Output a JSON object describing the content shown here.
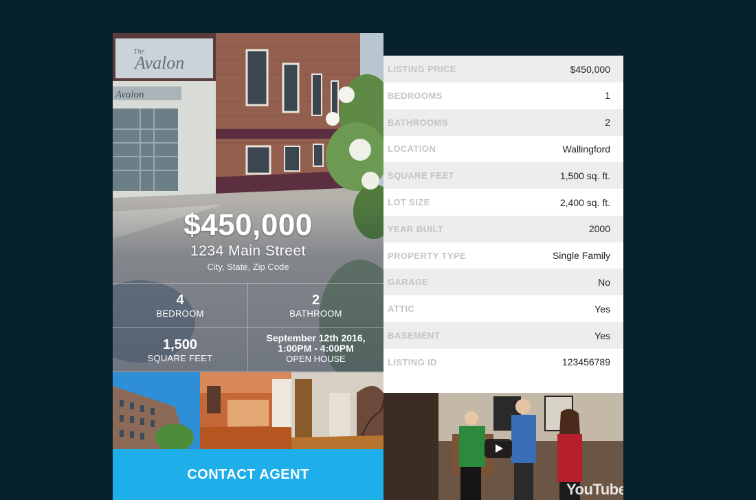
{
  "listing": {
    "price": "$450,000",
    "address": "1234 Main Street",
    "city_line": "City, State, Zip Code",
    "building_sign_1": "The Avalon",
    "building_sign_2": "Avalon",
    "stats": {
      "bedroom_num": "4",
      "bedroom_label": "BEDROOM",
      "bathroom_num": "2",
      "bathroom_label": "BATHROOM",
      "sqft_num": "1,500",
      "sqft_label": "SQUARE FEET",
      "open_house_date": "September 12th 2016,",
      "open_house_time": "1:00PM - 4:00PM",
      "open_house_label": "OPEN HOUSE"
    },
    "contact_label": "CONTACT AGENT"
  },
  "details": [
    {
      "label": "LISTING PRICE",
      "value": "$450,000"
    },
    {
      "label": "BEDROOMS",
      "value": "1"
    },
    {
      "label": "BATHROOMS",
      "value": "2"
    },
    {
      "label": "LOCATION",
      "value": "Wallingford"
    },
    {
      "label": "SQUARE FEET",
      "value": "1,500 sq. ft."
    },
    {
      "label": "LOT SIZE",
      "value": "2,400 sq. ft."
    },
    {
      "label": "YEAR BUILT",
      "value": "2000"
    },
    {
      "label": "PROPERTY TYPE",
      "value": "Single Family"
    },
    {
      "label": "GARAGE",
      "value": "No"
    },
    {
      "label": "ATTIC",
      "value": "Yes"
    },
    {
      "label": "BASEMENT",
      "value": "Yes"
    },
    {
      "label": "LISTING ID",
      "value": "123456789"
    }
  ],
  "video": {
    "watermark": "YouTube",
    "play_icon": "play-icon"
  },
  "colors": {
    "background": "#07222e",
    "accent": "#1eaee9",
    "row_shade": "#ededed"
  }
}
